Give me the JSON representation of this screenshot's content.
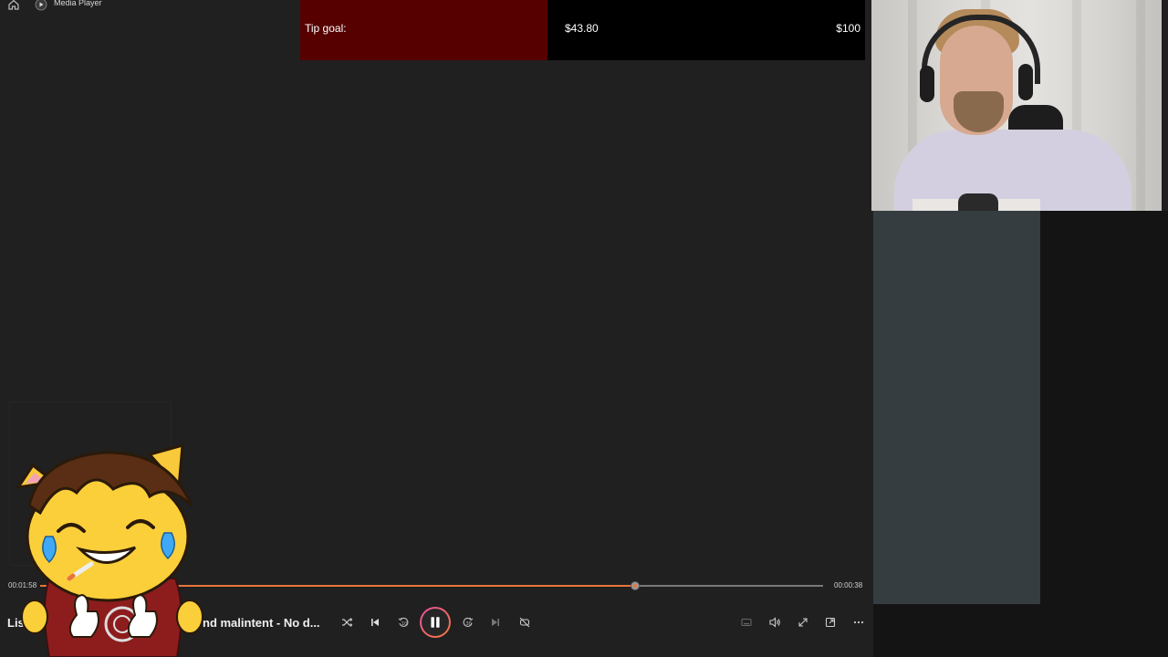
{
  "titlebar": {
    "app_name": "Media Player",
    "home_icon": "home-icon",
    "app_icon": "play-circle-icon"
  },
  "tip_goal": {
    "label": "Tip goal:",
    "current": "$43.80",
    "target": "$100",
    "progress": 0.438,
    "fill_color": "#560000"
  },
  "player": {
    "time_elapsed": "00:01:58",
    "time_remaining": "00:00:38",
    "progress": 0.76,
    "accent": "#e8743b",
    "title_left": "Liss tea",
    "title_right": "nd malintent - No d...",
    "controls": [
      {
        "name": "shuffle-icon"
      },
      {
        "name": "previous-icon"
      },
      {
        "name": "rewind-10-icon"
      },
      {
        "name": "pause-icon"
      },
      {
        "name": "forward-30-icon"
      },
      {
        "name": "next-icon"
      },
      {
        "name": "repeat-off-icon"
      }
    ],
    "right_controls": [
      {
        "name": "miniplayer-icon"
      },
      {
        "name": "volume-icon"
      },
      {
        "name": "fullscreen-icon"
      },
      {
        "name": "cast-icon"
      },
      {
        "name": "more-icon"
      }
    ]
  }
}
